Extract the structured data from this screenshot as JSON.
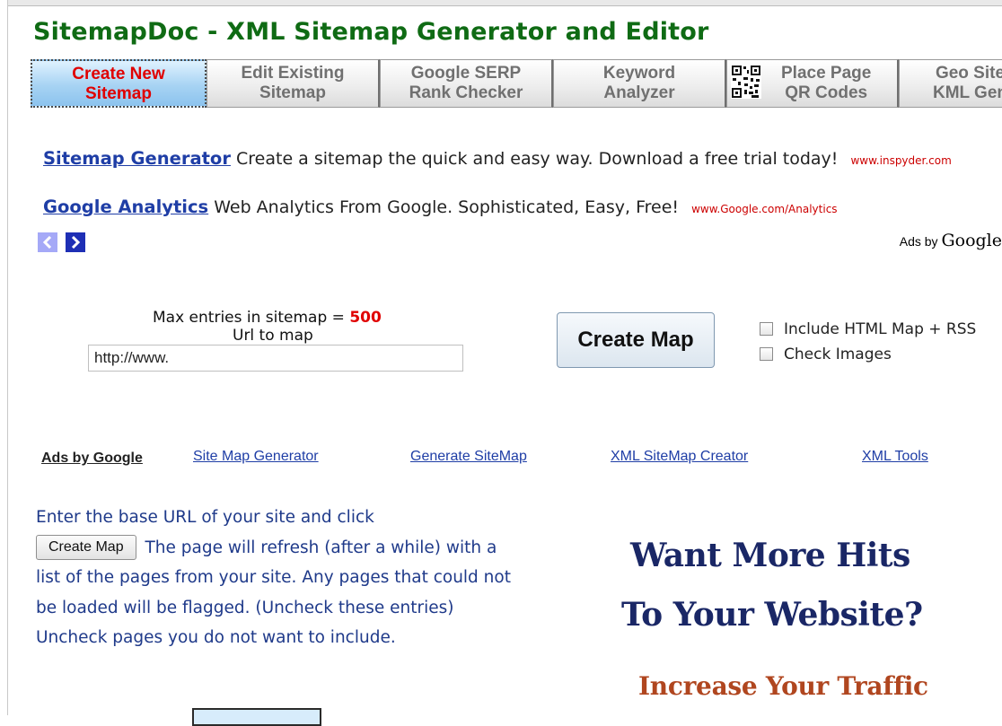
{
  "header": {
    "title": "SitemapDoc - XML Sitemap Generator and Editor"
  },
  "tabs": [
    {
      "line1": "Create New",
      "line2": "Sitemap"
    },
    {
      "line1": "Edit Existing",
      "line2": "Sitemap"
    },
    {
      "line1": "Google SERP",
      "line2": "Rank Checker"
    },
    {
      "line1": "Keyword",
      "line2": "Analyzer"
    },
    {
      "line1": "Place Page",
      "line2": "QR Codes"
    },
    {
      "line1": "Geo Site",
      "line2": "KML Gen"
    }
  ],
  "ads": [
    {
      "title": "Sitemap Generator",
      "text": "Create a sitemap the quick and easy way. Download a free trial today!",
      "url": "www.inspyder.com"
    },
    {
      "title": "Google Analytics",
      "text": "Web Analytics From Google. Sophisticated, Easy, Free!",
      "url": "www.Google.com/Analytics"
    }
  ],
  "ads_by": {
    "prefix": "Ads by",
    "brand": "Google"
  },
  "form": {
    "max_label": "Max entries in sitemap =",
    "max_value": "500",
    "url_label": "Url to map",
    "url_value": "http://www.",
    "create_button": "Create Map",
    "checkbox_html": "Include HTML Map + RSS",
    "checkbox_images": "Check Images"
  },
  "ad_links": {
    "label": "Ads by Google",
    "items": [
      "Site Map Generator",
      "Generate SiteMap",
      "XML SiteMap Creator",
      "XML Tools"
    ]
  },
  "instructions": {
    "part1": "Enter the base URL of your site and click",
    "button": "Create Map",
    "part2": "The page will refresh (after a while) with a list of the pages from your site. Any pages that could not be loaded will be flagged. (Uncheck these entries) Uncheck pages you do not want to include."
  },
  "banner": {
    "line1": "Want More Hits",
    "line2": "To Your Website?",
    "line3": "Increase Your Traffic"
  },
  "colors": {
    "title_green": "#0f6b14",
    "active_tab_blue": "#a7d3f3",
    "active_tab_text": "#e00000",
    "link_blue": "#1f3ea6",
    "banner_navy": "#1a2766",
    "banner_orange": "#b0461f"
  }
}
